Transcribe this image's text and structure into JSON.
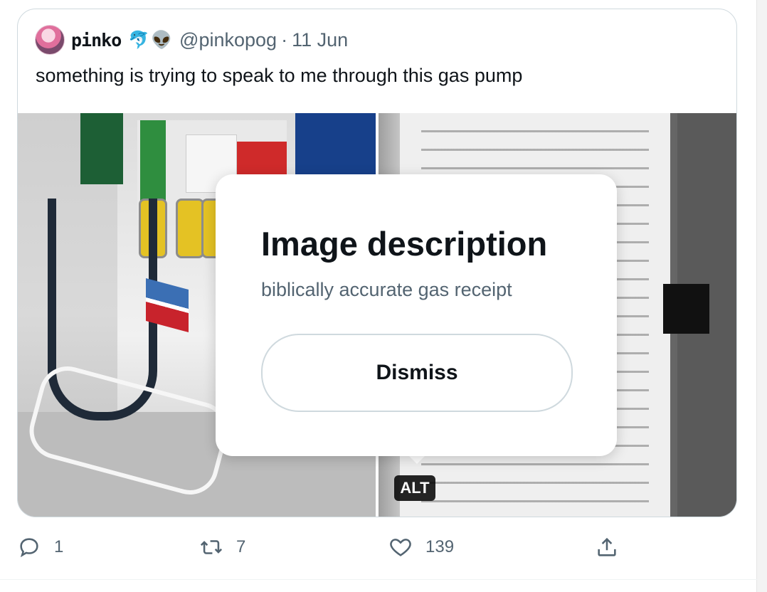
{
  "tweet": {
    "display_name": "pinko",
    "name_emoji_1": "🐬",
    "name_emoji_2": "👽",
    "handle": "@pinkopog",
    "separator": "·",
    "date": "11 Jun",
    "text": "something is trying to speak to me through this gas pump"
  },
  "media": {
    "alt_badge": "ALT"
  },
  "alt_popup": {
    "title": "Image description",
    "description": "biblically accurate gas receipt",
    "dismiss_label": "Dismiss"
  },
  "actions": {
    "replies": "1",
    "retweets": "7",
    "likes": "139"
  },
  "icons": {
    "reply": "reply-icon",
    "retweet": "retweet-icon",
    "like": "heart-icon",
    "share": "share-icon"
  },
  "colors": {
    "text_primary": "#0f1419",
    "text_secondary": "#536471",
    "border": "#cfd9de"
  }
}
